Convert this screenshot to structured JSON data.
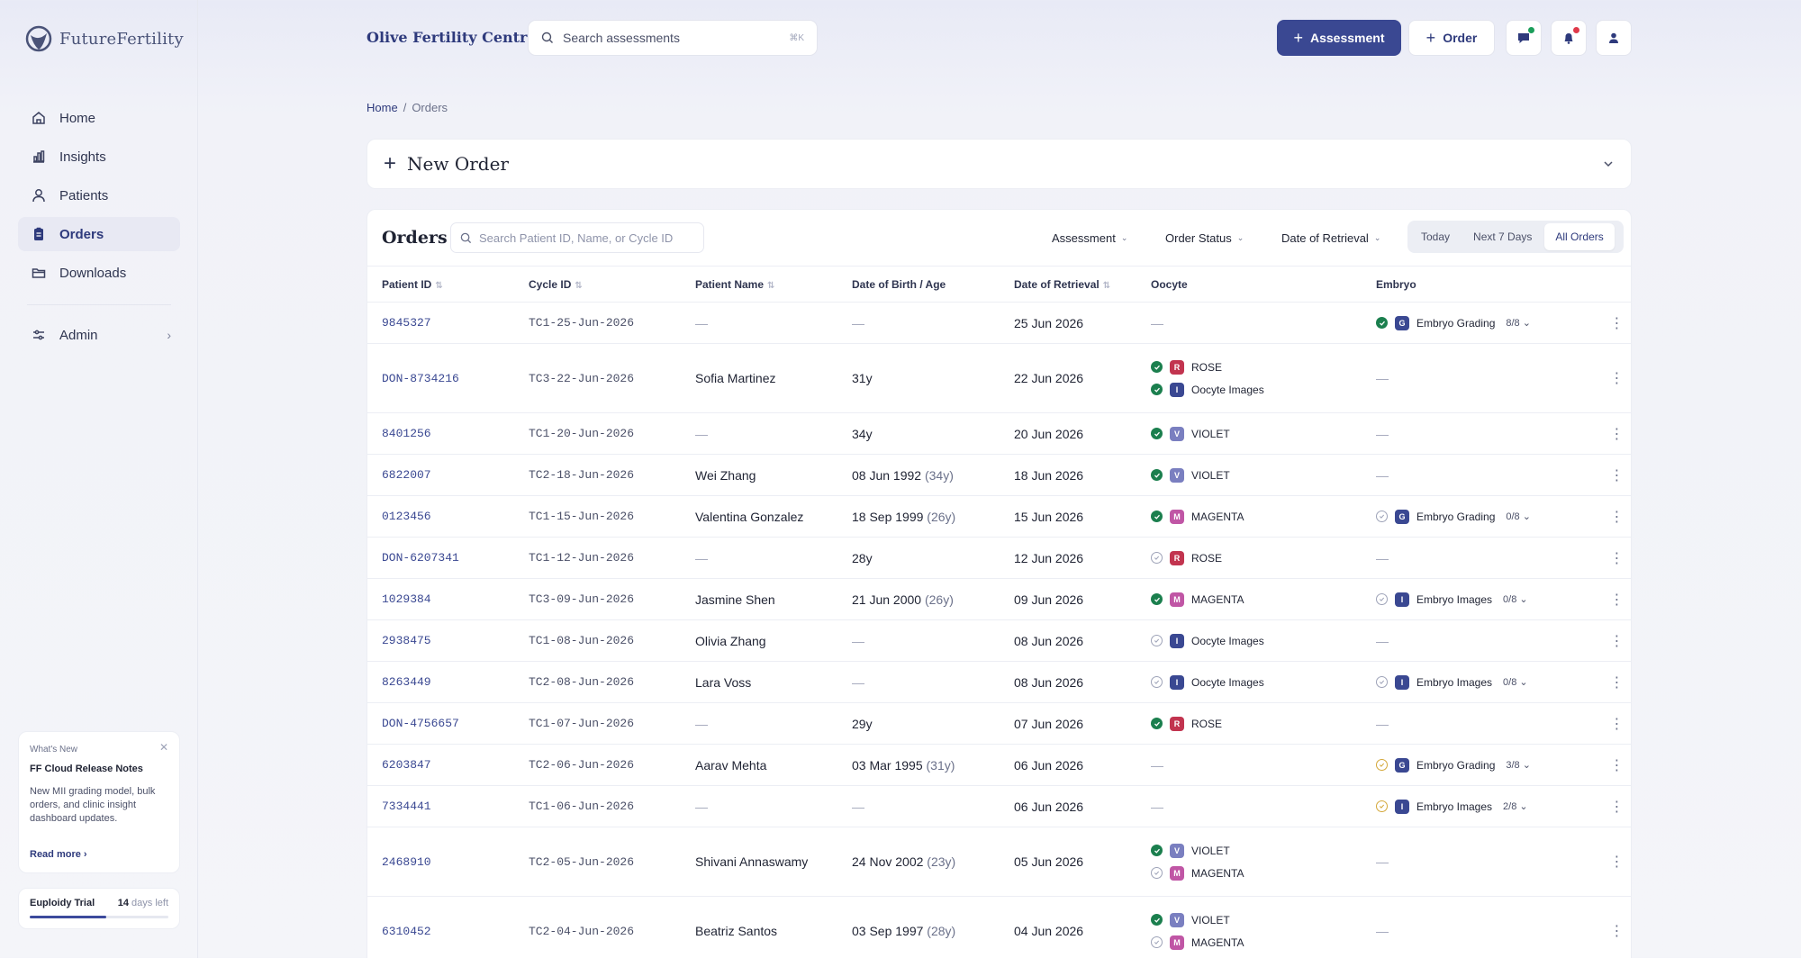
{
  "brand": {
    "name": "FutureFertility"
  },
  "nav": {
    "items": [
      {
        "label": "Home",
        "icon": "home-icon"
      },
      {
        "label": "Insights",
        "icon": "bar-chart-icon"
      },
      {
        "label": "Patients",
        "icon": "user-icon"
      },
      {
        "label": "Orders",
        "icon": "clipboard-icon",
        "active": true
      },
      {
        "label": "Downloads",
        "icon": "folder-icon"
      }
    ],
    "admin": {
      "label": "Admin"
    }
  },
  "whats_new": {
    "label": "What's New",
    "title": "FF Cloud Release Notes",
    "desc": "New MII grading model, bulk orders, and clinic insight dashboard updates.",
    "link": "Read more ›"
  },
  "trial": {
    "label": "Euploidy Trial",
    "days": "14",
    "days_suffix": "days left",
    "progress": 0.55
  },
  "header": {
    "clinic": "Olive Fertility Centre",
    "search_placeholder": "Search assessments",
    "search_kbd": "⌘K",
    "assessment_btn": "Assessment",
    "order_btn": "Order"
  },
  "breadcrumb": {
    "home": "Home",
    "sep": "/",
    "current": "Orders"
  },
  "new_order": {
    "label": "New Order"
  },
  "orders": {
    "title": "Orders",
    "search_placeholder": "Search Patient ID, Name, or Cycle ID",
    "filters": {
      "assessment": "Assessment",
      "status": "Order Status",
      "retrieval": "Date of Retrieval"
    },
    "segments": {
      "today": "Today",
      "next7": "Next 7 Days",
      "all": "All Orders"
    },
    "columns": {
      "patient_id": "Patient ID",
      "cycle_id": "Cycle ID",
      "name": "Patient Name",
      "dob": "Date of Birth / Age",
      "retrieval": "Date of Retrieval",
      "oocyte": "Oocyte",
      "embryo": "Embryo"
    },
    "dash": "—",
    "rows": [
      {
        "pid": "9845327",
        "cid": "TC1-25-Jun-2026",
        "name": "—",
        "dob": "—",
        "age": "",
        "ret": "25 Jun 2026",
        "oocyte": [],
        "embryo": {
          "status": "done",
          "letter": "G",
          "label": "Embryo Grading",
          "count": "8/8"
        }
      },
      {
        "pid": "DON-8734216",
        "cid": "TC3-22-Jun-2026",
        "name": "Sofia Martinez",
        "dob": "31y",
        "age": "",
        "ret": "22 Jun 2026",
        "oocyte": [
          {
            "status": "done",
            "letter": "R",
            "label": "ROSE"
          },
          {
            "status": "done",
            "letter": "I",
            "label": "Oocyte Images"
          }
        ],
        "embryo": null
      },
      {
        "pid": "8401256",
        "cid": "TC1-20-Jun-2026",
        "name": "—",
        "dob": "34y",
        "age": "",
        "ret": "20 Jun 2026",
        "oocyte": [
          {
            "status": "done",
            "letter": "V",
            "label": "VIOLET"
          }
        ],
        "embryo": null
      },
      {
        "pid": "6822007",
        "cid": "TC2-18-Jun-2026",
        "name": "Wei Zhang",
        "dob": "08 Jun 1992",
        "age": "(34y)",
        "ret": "18 Jun 2026",
        "oocyte": [
          {
            "status": "done",
            "letter": "V",
            "label": "VIOLET"
          }
        ],
        "embryo": null
      },
      {
        "pid": "0123456",
        "cid": "TC1-15-Jun-2026",
        "name": "Valentina Gonzalez",
        "dob": "18 Sep 1999",
        "age": "(26y)",
        "ret": "15 Jun 2026",
        "oocyte": [
          {
            "status": "done",
            "letter": "M",
            "label": "MAGENTA"
          }
        ],
        "embryo": {
          "status": "pending",
          "letter": "G",
          "label": "Embryo Grading",
          "count": "0/8"
        }
      },
      {
        "pid": "DON-6207341",
        "cid": "TC1-12-Jun-2026",
        "name": "—",
        "dob": "28y",
        "age": "",
        "ret": "12 Jun 2026",
        "oocyte": [
          {
            "status": "pending",
            "letter": "R",
            "label": "ROSE"
          }
        ],
        "embryo": null
      },
      {
        "pid": "1029384",
        "cid": "TC3-09-Jun-2026",
        "name": "Jasmine Shen",
        "dob": "21 Jun 2000",
        "age": "(26y)",
        "ret": "09 Jun 2026",
        "oocyte": [
          {
            "status": "done",
            "letter": "M",
            "label": "MAGENTA"
          }
        ],
        "embryo": {
          "status": "pending",
          "letter": "I",
          "label": "Embryo Images",
          "count": "0/8"
        }
      },
      {
        "pid": "2938475",
        "cid": "TC1-08-Jun-2026",
        "name": "Olivia Zhang",
        "dob": "—",
        "age": "",
        "ret": "08 Jun 2026",
        "oocyte": [
          {
            "status": "pending",
            "letter": "I",
            "label": "Oocyte Images"
          }
        ],
        "embryo": null
      },
      {
        "pid": "8263449",
        "cid": "TC2-08-Jun-2026",
        "name": "Lara Voss",
        "dob": "—",
        "age": "",
        "ret": "08 Jun 2026",
        "oocyte": [
          {
            "status": "pending",
            "letter": "I",
            "label": "Oocyte Images"
          }
        ],
        "embryo": {
          "status": "pending",
          "letter": "I",
          "label": "Embryo Images",
          "count": "0/8"
        }
      },
      {
        "pid": "DON-4756657",
        "cid": "TC1-07-Jun-2026",
        "name": "—",
        "dob": "29y",
        "age": "",
        "ret": "07 Jun 2026",
        "oocyte": [
          {
            "status": "done",
            "letter": "R",
            "label": "ROSE"
          }
        ],
        "embryo": null
      },
      {
        "pid": "6203847",
        "cid": "TC2-06-Jun-2026",
        "name": "Aarav Mehta",
        "dob": "03 Mar 1995",
        "age": "(31y)",
        "ret": "06 Jun 2026",
        "oocyte": [],
        "embryo": {
          "status": "partial",
          "letter": "G",
          "label": "Embryo Grading",
          "count": "3/8"
        }
      },
      {
        "pid": "7334441",
        "cid": "TC1-06-Jun-2026",
        "name": "—",
        "dob": "—",
        "age": "",
        "ret": "06 Jun 2026",
        "oocyte": [],
        "embryo": {
          "status": "partial",
          "letter": "I",
          "label": "Embryo Images",
          "count": "2/8"
        }
      },
      {
        "pid": "2468910",
        "cid": "TC2-05-Jun-2026",
        "name": "Shivani Annaswamy",
        "dob": "24 Nov 2002",
        "age": "(23y)",
        "ret": "05 Jun 2026",
        "oocyte": [
          {
            "status": "done",
            "letter": "V",
            "label": "VIOLET"
          },
          {
            "status": "pending",
            "letter": "M",
            "label": "MAGENTA"
          }
        ],
        "embryo": null
      },
      {
        "pid": "6310452",
        "cid": "TC2-04-Jun-2026",
        "name": "Beatriz Santos",
        "dob": "03 Sep 1997",
        "age": "(28y)",
        "ret": "04 Jun 2026",
        "oocyte": [
          {
            "status": "done",
            "letter": "V",
            "label": "VIOLET"
          },
          {
            "status": "pending",
            "letter": "M",
            "label": "MAGENTA"
          }
        ],
        "embryo": null
      }
    ]
  },
  "colors": {
    "primary": "#3a4892",
    "done": "#1b7f4e",
    "rose": "#c2344f",
    "images": "#3a4892",
    "violet": "#7a7fc0",
    "magenta": "#c056a5",
    "grading": "#3a4892",
    "notif_green": "#1b9e5a",
    "notif_red": "#e0394a"
  }
}
